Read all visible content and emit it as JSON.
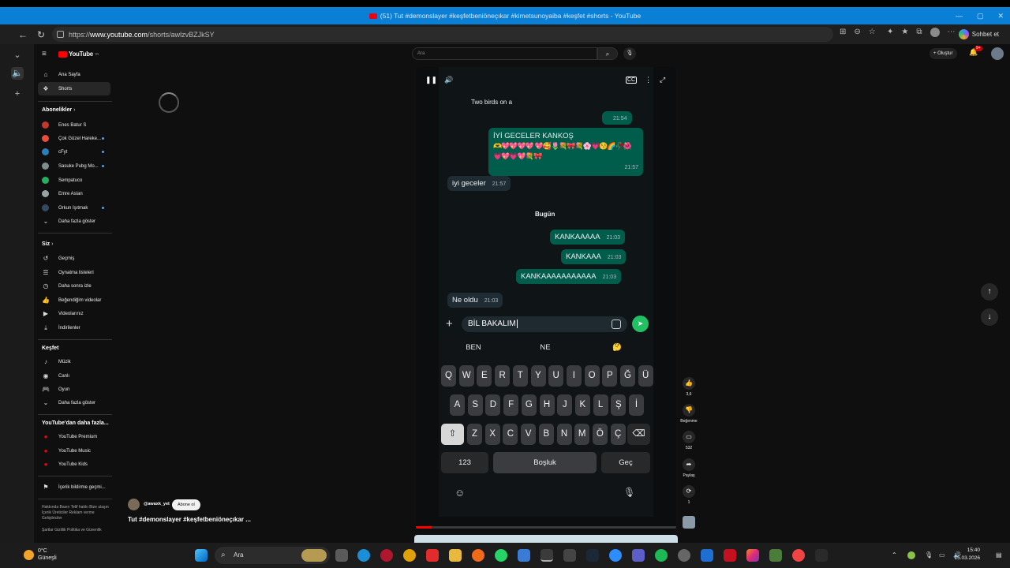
{
  "window": {
    "title": "(51) Tut #demonslayer #keşfetbeniöneçıkar #kimetsunoyaiba #keşfet #shorts - YouTube"
  },
  "browser": {
    "url_prefix": "https://",
    "url_host": "www.youtube.com",
    "url_path": "/shorts/awlzvBZJkSY",
    "copilot_label": "Sohbet et"
  },
  "youtube": {
    "logo": "YouTube",
    "region": "TR",
    "search_placeholder": "Ara",
    "create_label": "+ Oluştur",
    "bell_badge": "9+",
    "sidebar": {
      "main": [
        {
          "label": "Ana Sayfa",
          "icon": "home-icon"
        },
        {
          "label": "Shorts",
          "icon": "shorts-icon"
        }
      ],
      "subs_title": "Abonelikler",
      "subs": [
        {
          "label": "Enes Batur S",
          "color": "#c0392b",
          "dot": false
        },
        {
          "label": "Çok Güzel Hareke...",
          "color": "#e74c3c",
          "dot": true
        },
        {
          "label": "cFyt",
          "color": "#2980b9",
          "dot": true
        },
        {
          "label": "Sasuke Pubg Mo...",
          "color": "#7f8c8d",
          "dot": true
        },
        {
          "label": "Sempatuco",
          "color": "#27ae60",
          "dot": false
        },
        {
          "label": "Emre Aslan",
          "color": "#95a5a6",
          "dot": false
        },
        {
          "label": "Orkun Işıtmak",
          "color": "#34495e",
          "dot": true
        }
      ],
      "subs_more": "Daha fazla göster",
      "you_title": "Siz",
      "you": [
        {
          "label": "Geçmiş"
        },
        {
          "label": "Oynatma listeleri"
        },
        {
          "label": "Daha sonra izle"
        },
        {
          "label": "Beğendiğim videolar"
        },
        {
          "label": "Videolarınız"
        },
        {
          "label": "İndirilenler"
        }
      ],
      "explore_title": "Keşfet",
      "explore": [
        {
          "label": "Müzik"
        },
        {
          "label": "Canlı"
        },
        {
          "label": "Oyun"
        }
      ],
      "explore_more": "Daha fazla göster",
      "more_title": "YouTube'dan daha fazla...",
      "more": [
        {
          "label": "YouTube Premium"
        },
        {
          "label": "YouTube Music"
        },
        {
          "label": "YouTube Kids"
        }
      ],
      "report": "İçerik bildirme geçmi...",
      "footer1": "Hakkında  Basın  Telif hakkı  Bize ulaşın  İçerik Üreticiler  Reklam verme  Geliştiriciler",
      "footer2": "Şartlar  Gizlilik  Politika ve Güvenlik"
    },
    "short": {
      "channel": "@awaxk_yet",
      "subscribe": "Abone ol",
      "title": "Tut #demonslayer #keşfetbeniöneçıkar ...",
      "likes": "3,6",
      "dislike_label": "Beğenme",
      "comments": "532",
      "share_label": "Paylaş",
      "remix_count": "1"
    }
  },
  "chat": {
    "m1": {
      "text": "Two birds on a",
      "time": ""
    },
    "m2": {
      "text": "",
      "time": "21:54"
    },
    "m3": {
      "text": "İYİ GECELER KANKOŞ",
      "emojis": "🫶💖💖💖💖 💖🥰🌷💐🎀💐🌸💗😚🌈🥀🌺 💗💖💗💖💐🎀",
      "time": "21:57"
    },
    "m4": {
      "text": "iyi geceler",
      "time": "21:57"
    },
    "day": "Bugün",
    "m5": {
      "text": "KANKAAAAA",
      "time": "21:03"
    },
    "m6": {
      "text": "KANKAAA",
      "time": "21:03"
    },
    "m7": {
      "text": "KANKAAAAAAAAAAA",
      "time": "21:03"
    },
    "m8": {
      "text": "Ne oldu",
      "time": "21:03"
    },
    "input": "BİL BAKALIM"
  },
  "keyboard": {
    "suggestions": [
      "BEN",
      "NE",
      "🤔"
    ],
    "row1": [
      "Q",
      "W",
      "E",
      "R",
      "T",
      "Y",
      "U",
      "I",
      "O",
      "P",
      "Ğ",
      "Ü"
    ],
    "row2": [
      "A",
      "S",
      "D",
      "F",
      "G",
      "H",
      "J",
      "K",
      "L",
      "Ş",
      "İ"
    ],
    "row3": [
      "Z",
      "X",
      "C",
      "V",
      "B",
      "N",
      "M",
      "Ö",
      "Ç"
    ],
    "numbers": "123",
    "space": "Boşluk",
    "go": "Geç"
  },
  "taskbar": {
    "temp": "0°C",
    "weather": "Güneşli",
    "search": "Ara",
    "time": "15:40",
    "date": "15.03.2026"
  },
  "colors": {
    "titlebar": "#0a7fd6",
    "wa_out": "#005c4b",
    "wa_send": "#21c063",
    "yt_red": "#ff0000"
  }
}
